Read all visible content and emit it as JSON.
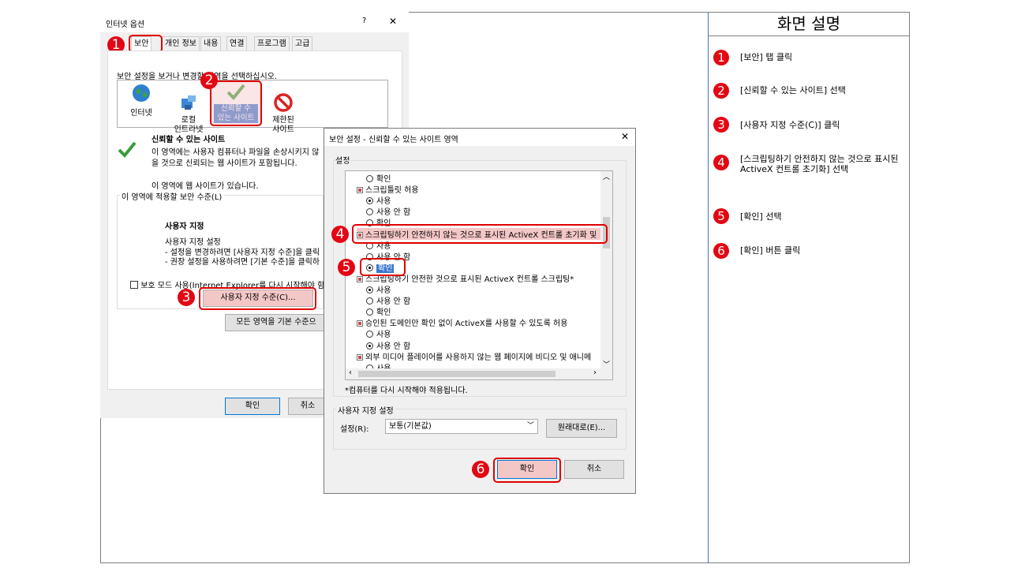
{
  "panel": {
    "title": "화면 설명",
    "steps": [
      {
        "num": "1",
        "text": "[보안] 탭 클릭"
      },
      {
        "num": "2",
        "text": "[신뢰할 수 있는 사이트] 선택"
      },
      {
        "num": "3",
        "text": "[사용자 지정 수준(C)] 클릭"
      },
      {
        "num": "4",
        "text": "[스크립팅하기 안전하지 않는 것으로 표시된 ActiveX 컨트롤 초기화] 선택"
      },
      {
        "num": "5",
        "text": "[확인] 선택"
      },
      {
        "num": "6",
        "text": "[확인] 버튼 클릭"
      }
    ]
  },
  "internet_options": {
    "title": "인터넷 옵션",
    "help": "?",
    "close": "✕",
    "tabs": [
      "보안",
      "개인 정보",
      "내용",
      "연결",
      "프로그램",
      "고급"
    ],
    "zone_prompt": "보안 설정을 보거나 변경할 영역을 선택하십시오.",
    "zones": [
      {
        "label": "인터넷"
      },
      {
        "label": "로컬\n인트라넷"
      },
      {
        "label": "신뢰할 수\n있는 사이트"
      },
      {
        "label": "제한된\n사이트"
      }
    ],
    "zone_title": "신뢰할 수 있는 사이트",
    "zone_desc1": "이 영역에는 사용자 컴퓨터나 파일을 손상시키지 않",
    "zone_desc2": "을 것으로 신뢰되는 웹 사이트가 포함됩니다.",
    "zone_has_sites": "이 영역에 웹 사이트가 있습니다.",
    "level_group": "이 영역에 적용할 보안 수준(L)",
    "custom_title": "사용자 지정",
    "custom_sub": "사용자 지정 설정",
    "custom_line1": "- 설정을 변경하려면 [사용자 지정 수준]을 클릭",
    "custom_line2": "- 권장 설정을 사용하려면 [기본 수준]을 클릭하",
    "protected_mode": "보호 모드 사용(Internet Explorer를 다시 시작해야 함)(",
    "custom_level_btn": "사용자 지정 수준(C)...",
    "default_all_btn": "모든 영역을 기본 수준으",
    "ok": "확인",
    "cancel": "취소"
  },
  "security_settings": {
    "title": "보안 설정 - 신뢰할 수 있는 사이트 영역",
    "close": "✕",
    "settings_label": "설정",
    "items": [
      {
        "type": "radio",
        "text": "확인",
        "on": false
      },
      {
        "type": "head",
        "text": "스크립틀릿 허용"
      },
      {
        "type": "radio",
        "text": "사용",
        "on": true
      },
      {
        "type": "radio",
        "text": "사용 안 함",
        "on": false
      },
      {
        "type": "radio",
        "text": "확인",
        "on": false
      },
      {
        "type": "head",
        "text": "스크립팅하기 안전하지 않는 것으로 표시된 ActiveX 컨트롤 초기화 및"
      },
      {
        "type": "radio",
        "text": "사용",
        "on": false
      },
      {
        "type": "radio",
        "text": "사용 안 함",
        "on": false
      },
      {
        "type": "radio",
        "text": "확인",
        "on": true
      },
      {
        "type": "head",
        "text": "스크립팅하기 안전한 것으로 표시된 ActiveX 컨트롤 스크립팅*"
      },
      {
        "type": "radio",
        "text": "사용",
        "on": true
      },
      {
        "type": "radio",
        "text": "사용 안 함",
        "on": false
      },
      {
        "type": "radio",
        "text": "확인",
        "on": false
      },
      {
        "type": "head",
        "text": "승인된 도메인만 확인 없이 ActiveX를 사용할 수 있도록 허용"
      },
      {
        "type": "radio",
        "text": "사용",
        "on": false
      },
      {
        "type": "radio",
        "text": "사용 안 함",
        "on": true
      },
      {
        "type": "head",
        "text": "외부 미디어 플레이어를 사용하지 않는 웹 페이지에 비디오 및 애니메"
      },
      {
        "type": "radio",
        "text": "사용",
        "on": false
      }
    ],
    "restart_note": "*컴퓨터를 다시 시작해야 적용됩니다.",
    "custom_group": "사용자 지정 설정",
    "reset_label": "설정(R):",
    "reset_value": "보통(기본값)",
    "reset_btn": "원래대로(E)...",
    "ok": "확인",
    "cancel": "취소"
  },
  "colors": {
    "badge": "#e30613",
    "highlight": "#f4c7c7",
    "accent": "#0078d7"
  }
}
